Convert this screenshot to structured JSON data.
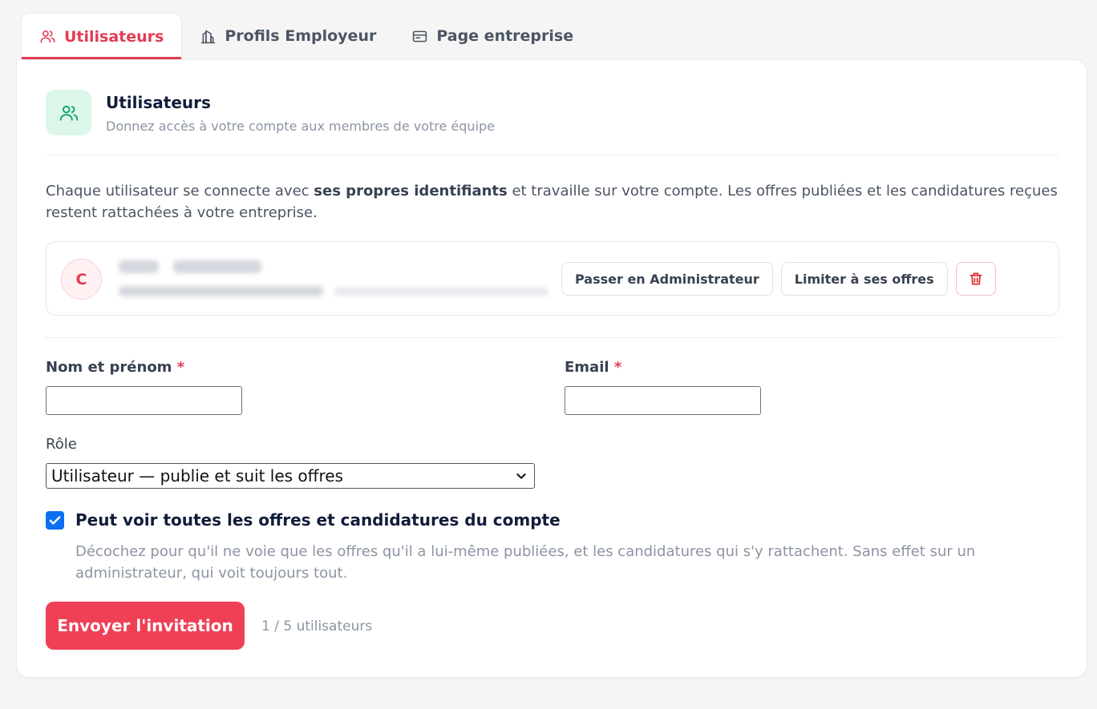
{
  "tabs": [
    {
      "label": "Utilisateurs",
      "icon": "users-icon",
      "active": true
    },
    {
      "label": "Profils Employeur",
      "icon": "building-icon",
      "active": false
    },
    {
      "label": "Page entreprise",
      "icon": "browser-window-icon",
      "active": false
    }
  ],
  "section": {
    "title": "Utilisateurs",
    "subtitle": "Donnez accès à votre compte aux membres de votre équipe",
    "icon": "users-icon"
  },
  "intro": {
    "before": "Chaque utilisateur se connecte avec ",
    "bold": "ses propres identifiants",
    "after": " et travaille sur votre compte. Les offres publiées et les candidatures reçues restent rattachées à votre entreprise."
  },
  "user": {
    "initial": "C",
    "promote_label": "Passer en Administrateur",
    "limit_label": "Limiter à ses offres",
    "delete_icon": "trash-icon"
  },
  "form": {
    "name_label": "Nom et prénom",
    "email_label": "Email",
    "required_mark": "*",
    "name_value": "",
    "email_value": "",
    "role_label": "Rôle",
    "role_value": "Utilisateur — publie et suit les offres",
    "checkbox_checked": true,
    "checkbox_label": "Peut voir toutes les offres et candidatures du compte",
    "checkbox_help": "Décochez pour qu'il ne voie que les offres qu'il a lui-même publiées, et les candidatures qui s'y rattachent. Sans effet sur un administrateur, qui voit toujours tout.",
    "submit_label": "Envoyer l'invitation",
    "counter": "1 / 5 utilisateurs"
  },
  "colors": {
    "accent": "#e23c53",
    "primary_button": "#ef4056",
    "icon_tile": "#dcf7ea",
    "icon_green": "#16a36a",
    "checkbox": "#0b6ff2"
  }
}
